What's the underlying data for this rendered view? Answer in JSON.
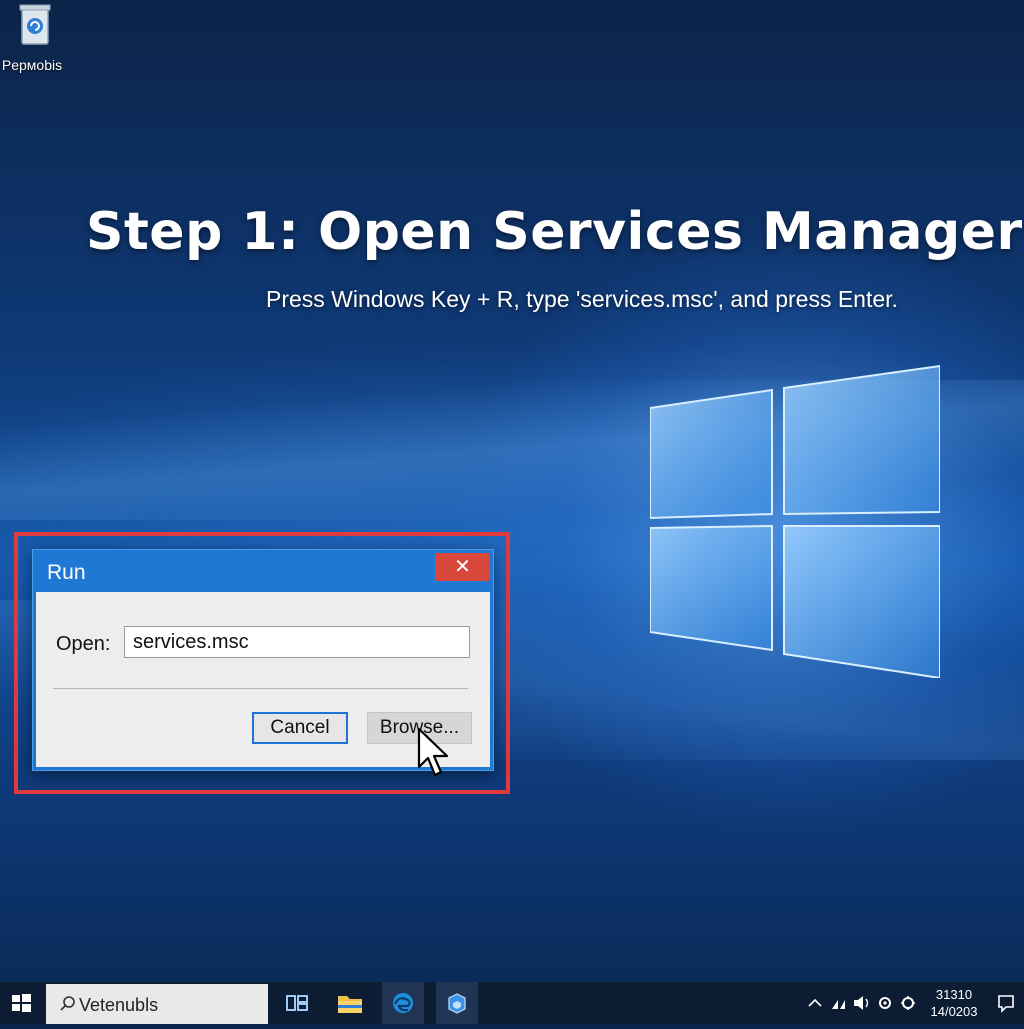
{
  "desktop": {
    "icon_label": "Pермobis",
    "icon": "recycle-bin-icon"
  },
  "tutorial": {
    "heading": "Step 1: Open Services Manager",
    "instruction": "Press Windows Key + R, type 'services.msc', and press Enter."
  },
  "highlight_color": "#e0393e",
  "run_dialog": {
    "title": "Run",
    "close_label": "✕",
    "open_label": "Open:",
    "open_value": "services.msc",
    "cancel_label": "Cancel",
    "browse_label": "Browse...",
    "accent": "#1e78d4"
  },
  "taskbar": {
    "search_text": "Vetenubls",
    "apps": [
      "task-view-icon",
      "file-explorer-icon",
      "edge-icon",
      "store-icon"
    ],
    "tray_icons": [
      "chevron-up-icon",
      "network-icon",
      "volume-icon",
      "settings-icon",
      "location-icon"
    ],
    "clock_time": "31310",
    "clock_date": "14/0203",
    "notifications_icon": "notifications-icon"
  }
}
